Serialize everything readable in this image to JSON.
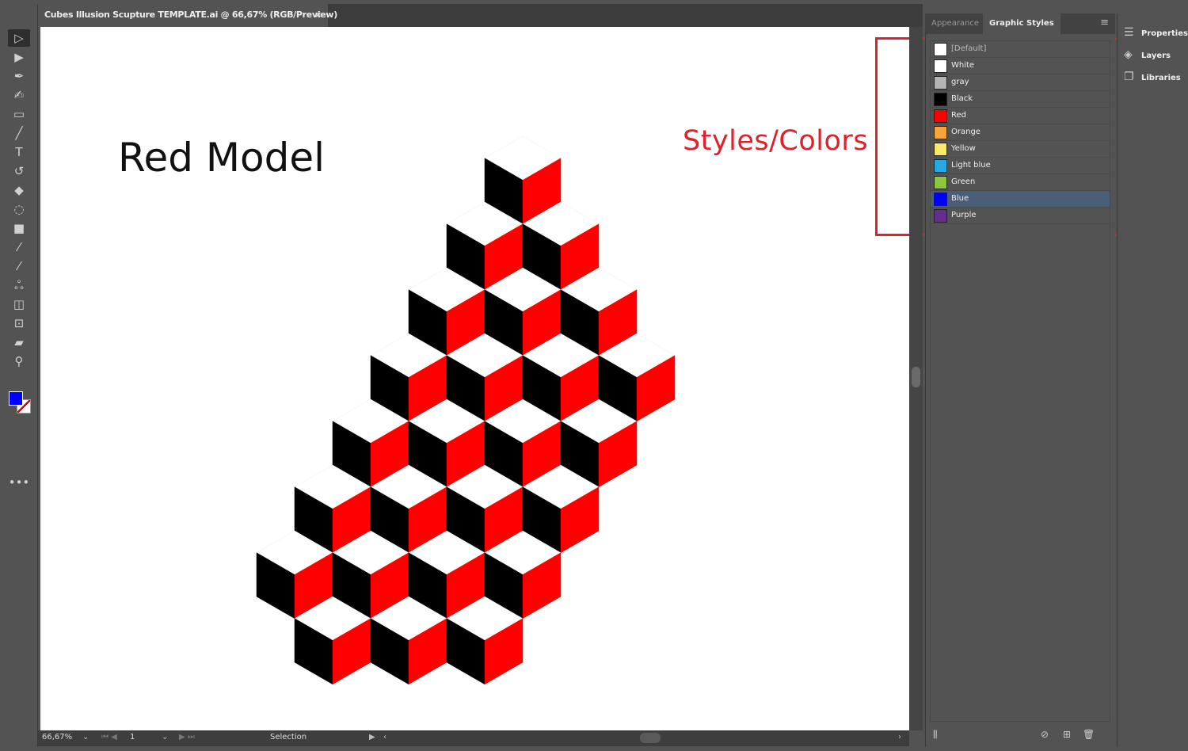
{
  "document_tab": {
    "title": "Cubes Illusion Scupture TEMPLATE.ai @ 66,67% (RGB/Preview)",
    "close": "×"
  },
  "toolbar": {
    "tools": [
      {
        "name": "selection-tool-icon",
        "glyph": "▷"
      },
      {
        "name": "direct-selection-tool-icon",
        "glyph": "▶"
      },
      {
        "name": "pen-tool-icon",
        "glyph": "✒"
      },
      {
        "name": "curvature-tool-icon",
        "glyph": "✍"
      },
      {
        "name": "rectangle-tool-icon",
        "glyph": "▭"
      },
      {
        "name": "paintbrush-tool-icon",
        "glyph": "╱"
      },
      {
        "name": "type-tool-icon",
        "glyph": "T"
      },
      {
        "name": "rotate-tool-icon",
        "glyph": "↺"
      },
      {
        "name": "eraser-tool-icon",
        "glyph": "◆"
      },
      {
        "name": "lasso-tool-icon",
        "glyph": "◌"
      },
      {
        "name": "gradient-tool-icon",
        "glyph": "■"
      },
      {
        "name": "eyedropper-tool-icon",
        "glyph": "⁄"
      },
      {
        "name": "measure-eyedropper-icon",
        "glyph": "⁄"
      },
      {
        "name": "puppet-warp-tool-icon",
        "glyph": "ஃ"
      },
      {
        "name": "shape-builder-tool-icon",
        "glyph": "◫"
      },
      {
        "name": "artboard-tool-icon",
        "glyph": "⊡"
      },
      {
        "name": "slice-tool-icon",
        "glyph": "▰"
      },
      {
        "name": "zoom-tool-icon",
        "glyph": "⚲"
      }
    ],
    "fill_color": "#0000ff",
    "more": "•••"
  },
  "canvas": {
    "title": "Red Model",
    "annotation": "Styles/Colors",
    "annotation_color": "#e0202a",
    "cube_colors": {
      "top": "#ffffff",
      "left": "#000000",
      "right": "#ff0000"
    }
  },
  "status_bar": {
    "zoom": "66,67%",
    "artboard": "1",
    "tool": "Selection"
  },
  "panel": {
    "tabs": [
      {
        "label": "Appearance",
        "active": false
      },
      {
        "label": "Graphic Styles",
        "active": true
      }
    ],
    "styles": [
      {
        "label": "[Default]",
        "color": "#ffffff"
      },
      {
        "label": "White",
        "color": "#ffffff"
      },
      {
        "label": "gray",
        "color": "#b3b3b3"
      },
      {
        "label": "Black",
        "color": "#000000"
      },
      {
        "label": "Red",
        "color": "#ff0000"
      },
      {
        "label": "Orange",
        "color": "#f7a53a"
      },
      {
        "label": "Yellow",
        "color": "#fbe96a"
      },
      {
        "label": "Light blue",
        "color": "#29a9e1"
      },
      {
        "label": "Green",
        "color": "#8cc63f"
      },
      {
        "label": "Blue",
        "color": "#0000ff",
        "selected": true
      },
      {
        "label": "Purple",
        "color": "#662d91"
      }
    ]
  },
  "dock": {
    "items": [
      {
        "label": "Properties",
        "icon": "properties-icon"
      },
      {
        "label": "Layers",
        "icon": "layers-icon"
      },
      {
        "label": "Libraries",
        "icon": "libraries-icon"
      }
    ]
  }
}
